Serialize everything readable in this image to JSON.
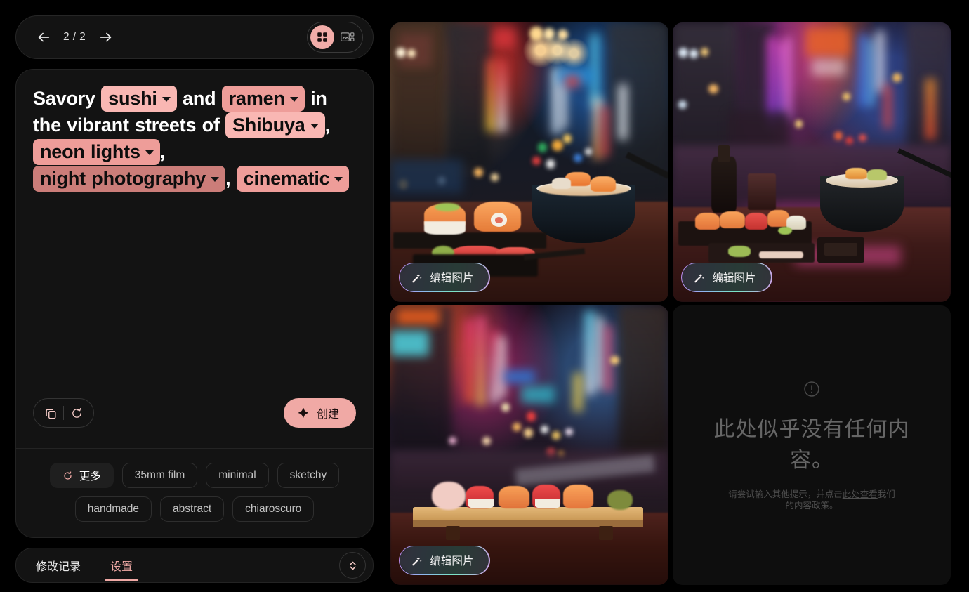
{
  "nav": {
    "back_icon": "arrow-left-icon",
    "counter": "2 / 2",
    "forward_icon": "arrow-right-icon",
    "views": [
      {
        "name": "grid-view",
        "icon": "grid-icon",
        "active": true
      },
      {
        "name": "detail-view",
        "icon": "image-detail-icon",
        "active": false
      }
    ]
  },
  "prompt": {
    "segments": [
      {
        "type": "text",
        "value": "Savory"
      },
      {
        "type": "chip",
        "value": "sushi",
        "shade": "light"
      },
      {
        "type": "text",
        "value": "and"
      },
      {
        "type": "chip",
        "value": "ramen",
        "shade": "medium"
      },
      {
        "type": "text",
        "value": "in the vibrant streets of"
      },
      {
        "type": "chip",
        "value": "Shibuya",
        "shade": "light"
      },
      {
        "type": "text",
        "value": ","
      },
      {
        "type": "chip",
        "value": "neon lights",
        "shade": "medium"
      },
      {
        "type": "text",
        "value": ","
      },
      {
        "type": "chip",
        "value": "night photography",
        "shade": "dark"
      },
      {
        "type": "text",
        "value": ","
      },
      {
        "type": "chip",
        "value": "cinematic",
        "shade": "medium"
      }
    ],
    "chip_colors": {
      "light": "#f9b7b3",
      "medium": "#ee9d99",
      "dark": "#cb7d79"
    },
    "actions": {
      "copy_icon": "copy-icon",
      "reset_icon": "refresh-icon",
      "create_label": "创建",
      "create_icon": "sparkle-icon",
      "create_color": "#f0a9a5"
    }
  },
  "suggestions": {
    "more_label": "更多",
    "more_icon": "refresh-icon",
    "row1": [
      "35mm film",
      "minimal",
      "sketchy"
    ],
    "row2": [
      "handmade",
      "abstract",
      "chiaroscuro"
    ]
  },
  "tabs": {
    "items": [
      {
        "label": "修改记录",
        "active": false
      },
      {
        "label": "设置",
        "active": true
      }
    ],
    "expand_icon": "chevron-up-down-icon",
    "accent": "#f0a9a5"
  },
  "results": {
    "tiles": [
      {
        "kind": "image",
        "alt": "Sushi platter and a ramen bowl on a wooden table with blurred neon Shibuya street at night",
        "edit_label": "编辑图片",
        "edit_icon": "magic-wand-icon"
      },
      {
        "kind": "image",
        "alt": "Sushi set with soy sauce bottle, glass and ramen bowl on an outdoor table, purple and pink neon city bokeh",
        "edit_label": "编辑图片",
        "edit_icon": "magic-wand-icon"
      },
      {
        "kind": "image",
        "alt": "Row of nigiri sushi on a wooden board with ginger and wasabi, neon signs blurred behind",
        "edit_label": "编辑图片",
        "edit_icon": "magic-wand-icon"
      },
      {
        "kind": "empty",
        "icon": "alert-circle-icon",
        "title": "此处似乎没有任何内容。",
        "sub_before": "请尝试输入其他提示，并点击",
        "sub_link": "此处查看",
        "sub_after": "我们的内容政策。"
      }
    ]
  }
}
